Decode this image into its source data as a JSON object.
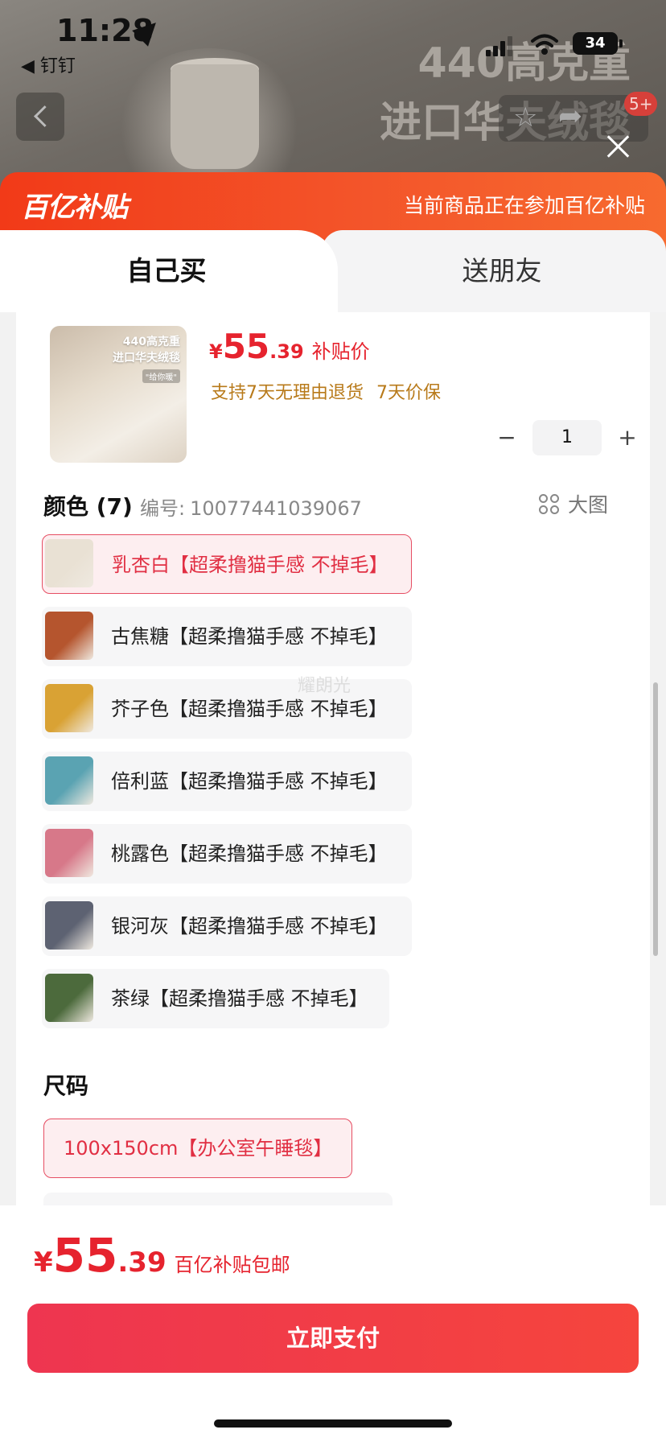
{
  "status_bar": {
    "time": "11:28",
    "back_app": "◀ 钉钉",
    "battery": "34"
  },
  "background_page": {
    "promo_line1": "440高克重",
    "promo_line2": "进口华夫绒毯",
    "cart_badge": "5+",
    "icons": [
      "back-icon",
      "star-icon",
      "share-icon",
      "close-icon"
    ]
  },
  "subsidy_banner": {
    "logo": "百亿补贴",
    "note": "当前商品正在参加百亿补贴"
  },
  "tabs": [
    {
      "label": "自己买",
      "active": true
    },
    {
      "label": "送朋友",
      "active": false
    }
  ],
  "product": {
    "thumb_text": "440高克重\n进口华夫绒毯",
    "thumb_tag": "\"给你暖\"",
    "price_symbol": "¥",
    "price_int": "55",
    "price_dec": ".39",
    "price_label": "补贴价",
    "guarantees": [
      "支持7天无理由退货",
      "7天价保"
    ],
    "quantity": "1"
  },
  "color_section": {
    "title": "颜色 (7)",
    "code_label": "编号:",
    "code": "10077441039067",
    "bigview_label": "大图",
    "watermark": "耀朗光",
    "options": [
      {
        "label": "乳杏白【超柔撸猫手感 不掉毛】",
        "selected": true,
        "swatch": "#e9e1d4"
      },
      {
        "label": "古焦糖【超柔撸猫手感 不掉毛】",
        "selected": false,
        "swatch": "#b5552e"
      },
      {
        "label": "芥子色【超柔撸猫手感 不掉毛】",
        "selected": false,
        "swatch": "#d9a234"
      },
      {
        "label": "倍利蓝【超柔撸猫手感 不掉毛】",
        "selected": false,
        "swatch": "#5aa3b2"
      },
      {
        "label": "桃露色【超柔撸猫手感 不掉毛】",
        "selected": false,
        "swatch": "#d77889"
      },
      {
        "label": "银河灰【超柔撸猫手感 不掉毛】",
        "selected": false,
        "swatch": "#5d6272"
      },
      {
        "label": "茶绿【超柔撸猫手感 不掉毛】",
        "selected": false,
        "swatch": "#4c6a3c"
      }
    ]
  },
  "size_section": {
    "title": "尺码",
    "options": [
      {
        "label": "100x150cm【办公室午睡毯】",
        "selected": true
      }
    ]
  },
  "footer": {
    "price_symbol": "¥",
    "price_int": "55",
    "price_dec": ".39",
    "note": "百亿补贴包邮",
    "pay_label": "立即支付"
  },
  "colors": {
    "accent_red": "#e6232e",
    "subsidy_orange": "#f3552a",
    "selected_border": "#e64e63",
    "guarantee_gold": "#b87a1a"
  }
}
